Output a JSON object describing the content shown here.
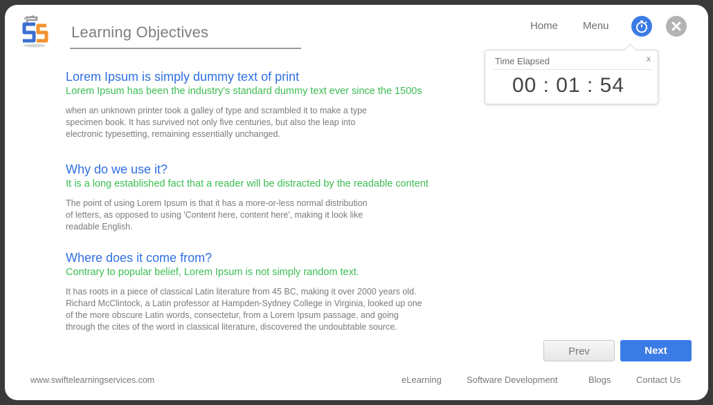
{
  "header": {
    "title": "Learning Objectives",
    "nav": {
      "home": "Home",
      "menu": "Menu"
    }
  },
  "timer_popup": {
    "title": "Time Elapsed",
    "close_label": "x",
    "value": "00 : 01 : 54"
  },
  "sections": [
    {
      "heading": "Lorem Ipsum is simply dummy text of print",
      "subheading": "Lorem Ipsum has been the industry's standard dummy text ever since the 1500s",
      "body": [
        "when an unknown printer took a galley of type and scrambled it to make a type",
        "specimen book. It has survived not only five centuries, but also the leap into",
        "electronic typesetting, remaining essentially unchanged."
      ]
    },
    {
      "heading": "Why do we use it?",
      "subheading": "It is a long established fact that a reader will be distracted by the readable content",
      "body": [
        "The point of using Lorem Ipsum is that it has a more-or-less normal distribution",
        "of letters, as opposed to using 'Content here, content here', making it look like",
        "readable English."
      ]
    },
    {
      "heading": "Where does it come from?",
      "subheading": "Contrary to popular belief, Lorem Ipsum is not simply random text.",
      "body": [
        "It has roots in a piece of classical Latin literature from 45 BC, making it over 2000 years old.",
        "Richard McClintock, a Latin professor at Hampden-Sydney College in Virginia, looked up one",
        "of the more obscure Latin words, consectetur, from a Lorem Ipsum passage, and going",
        "through the cites of the word in classical literature, discovered the undoubtable source."
      ]
    }
  ],
  "buttons": {
    "prev": "Prev",
    "next": "Next"
  },
  "footer": {
    "url": "www.swiftelearningservices.com",
    "links": [
      "eLearning",
      "Software Development",
      "Blogs",
      "Contact Us"
    ]
  },
  "colors": {
    "accent": "#3a7be6",
    "heading": "#2f6fe0",
    "subheading": "#3cbd52",
    "logo_blue": "#3a6fd0",
    "logo_orange": "#f2922f"
  },
  "icons": {
    "logo": "swift-logo-icon",
    "timer": "stopwatch-icon",
    "close": "close-icon"
  }
}
